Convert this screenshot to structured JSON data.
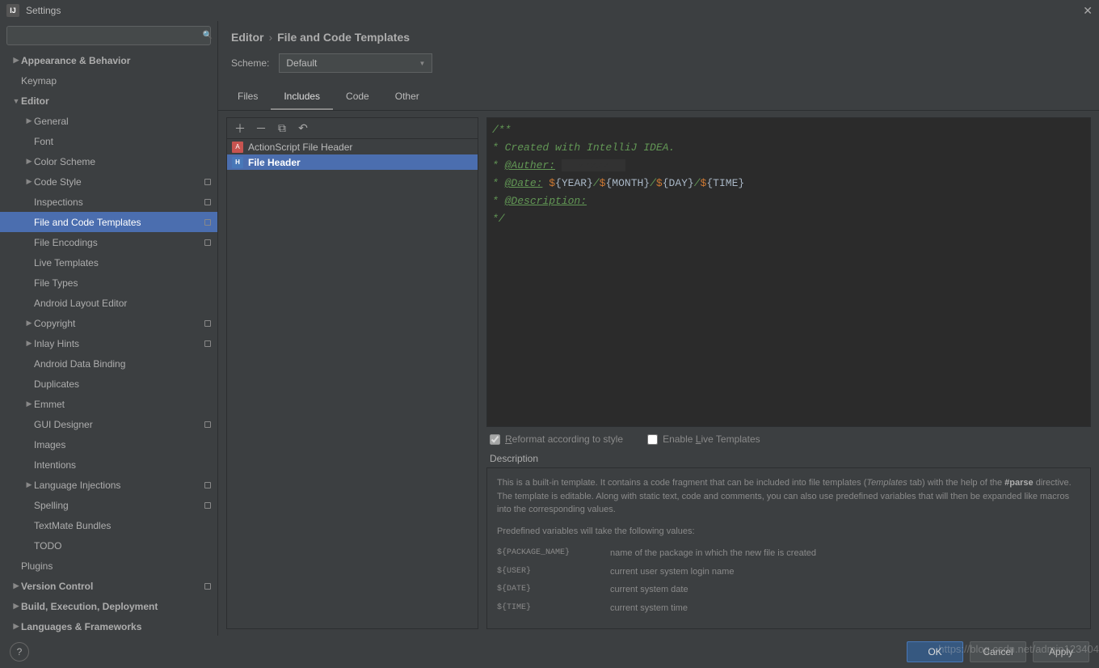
{
  "title": "Settings",
  "search_placeholder": "",
  "sidebar": [
    {
      "label": "Appearance & Behavior",
      "depth": 0,
      "chev": "▶",
      "bold": true
    },
    {
      "label": "Keymap",
      "depth": 0,
      "bold": true,
      "leaf": true
    },
    {
      "label": "Editor",
      "depth": 0,
      "chev": "▼",
      "bold": true
    },
    {
      "label": "General",
      "depth": 1,
      "chev": "▶",
      "leaf": false
    },
    {
      "label": "Font",
      "depth": 1,
      "leaf": true
    },
    {
      "label": "Color Scheme",
      "depth": 1,
      "chev": "▶"
    },
    {
      "label": "Code Style",
      "depth": 1,
      "chev": "▶",
      "orb": true
    },
    {
      "label": "Inspections",
      "depth": 1,
      "leaf": true,
      "orb": true
    },
    {
      "label": "File and Code Templates",
      "depth": 1,
      "leaf": true,
      "orb": true,
      "selected": true
    },
    {
      "label": "File Encodings",
      "depth": 1,
      "leaf": true,
      "orb": true
    },
    {
      "label": "Live Templates",
      "depth": 1,
      "leaf": true
    },
    {
      "label": "File Types",
      "depth": 1,
      "leaf": true
    },
    {
      "label": "Android Layout Editor",
      "depth": 1,
      "leaf": true
    },
    {
      "label": "Copyright",
      "depth": 1,
      "chev": "▶",
      "orb": true
    },
    {
      "label": "Inlay Hints",
      "depth": 1,
      "chev": "▶",
      "orb": true
    },
    {
      "label": "Android Data Binding",
      "depth": 1,
      "leaf": true
    },
    {
      "label": "Duplicates",
      "depth": 1,
      "leaf": true
    },
    {
      "label": "Emmet",
      "depth": 1,
      "chev": "▶"
    },
    {
      "label": "GUI Designer",
      "depth": 1,
      "leaf": true,
      "orb": true
    },
    {
      "label": "Images",
      "depth": 1,
      "leaf": true
    },
    {
      "label": "Intentions",
      "depth": 1,
      "leaf": true
    },
    {
      "label": "Language Injections",
      "depth": 1,
      "chev": "▶",
      "orb": true
    },
    {
      "label": "Spelling",
      "depth": 1,
      "leaf": true,
      "orb": true
    },
    {
      "label": "TextMate Bundles",
      "depth": 1,
      "leaf": true
    },
    {
      "label": "TODO",
      "depth": 1,
      "leaf": true
    },
    {
      "label": "Plugins",
      "depth": 0,
      "bold": true,
      "leaf": true
    },
    {
      "label": "Version Control",
      "depth": 0,
      "chev": "▶",
      "bold": true,
      "orb": true
    },
    {
      "label": "Build, Execution, Deployment",
      "depth": 0,
      "chev": "▶",
      "bold": true
    },
    {
      "label": "Languages & Frameworks",
      "depth": 0,
      "chev": "▶",
      "bold": true
    }
  ],
  "breadcrumb": {
    "root": "Editor",
    "leaf": "File and Code Templates"
  },
  "scheme": {
    "label": "Scheme:",
    "value": "Default"
  },
  "tabs": [
    "Files",
    "Includes",
    "Code",
    "Other"
  ],
  "active_tab": 1,
  "list": [
    {
      "label": "ActionScript File Header",
      "icon": "as"
    },
    {
      "label": "File Header",
      "icon": "fh",
      "selected": true
    }
  ],
  "editor_lines": [
    {
      "t": "/**",
      "cls": "c"
    },
    {
      "t": " * Created with IntelliJ IDEA.",
      "cls": "c"
    },
    {
      "html": " * <span class='u'>@Auther:</span> <span class='redacted'>xxxxx</span>",
      "cls": "c"
    },
    {
      "html": " * <span class='u'>@Date:</span> <span class='v'>$</span><span class='s'>{YEAR}</span>/<span class='v'>$</span><span class='s'>{MONTH}</span>/<span class='v'>$</span><span class='s'>{DAY}</span>/<span class='v'>$</span><span class='s'>{TIME}</span>",
      "cls": "c"
    },
    {
      "html": " * <span class='u'>@Description:</span>",
      "cls": "c"
    },
    {
      "t": " */",
      "cls": "c"
    }
  ],
  "checks": {
    "reformat": "Reformat according to style",
    "reformat_checked": true,
    "reformat_disabled": true,
    "live": "Enable Live Templates",
    "live_checked": false
  },
  "description_label": "Description",
  "description": {
    "p1a": "This is a built-in template. It contains a code fragment that can be included into file templates (",
    "p1i": "Templates",
    "p1b": " tab) with the help of the ",
    "p1c": "#parse",
    "p1d": " directive.",
    "p2": "The template is editable. Along with static text, code and comments, you can also use predefined variables that will then be expanded like macros into the corresponding values.",
    "p3": "Predefined variables will take the following values:",
    "vars": [
      {
        "k": "${PACKAGE_NAME}",
        "v": "name of the package in which the new file is created"
      },
      {
        "k": "${USER}",
        "v": "current user system login name"
      },
      {
        "k": "${DATE}",
        "v": "current system date"
      },
      {
        "k": "${TIME}",
        "v": "current system time"
      }
    ]
  },
  "buttons": {
    "ok": "OK",
    "cancel": "Cancel",
    "apply": "Apply"
  },
  "watermark": "https://blog.csdn.net/admin123404"
}
